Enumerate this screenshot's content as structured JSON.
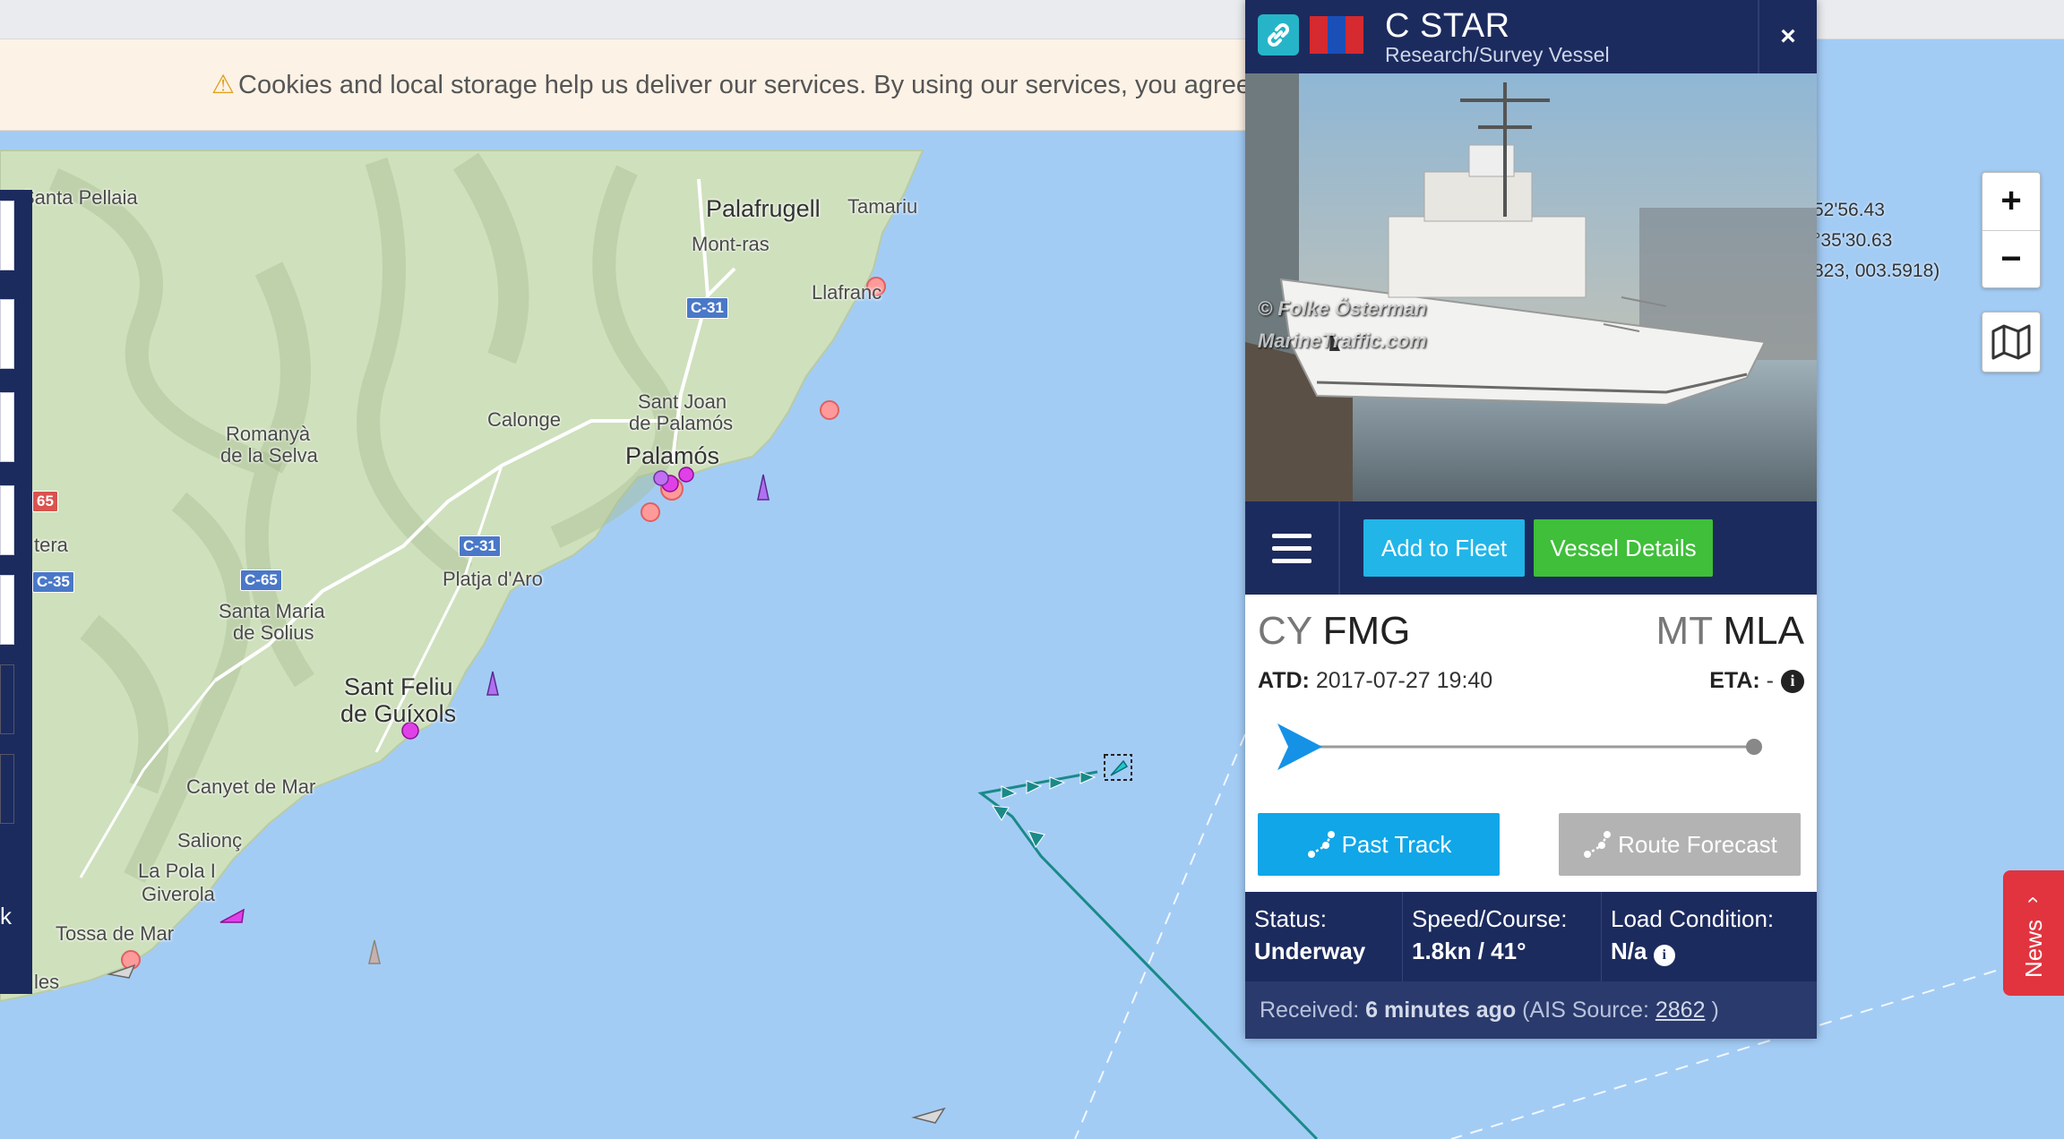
{
  "cookie_banner": {
    "icon": "warning-icon",
    "text": "Cookies and local storage help us deliver our services. By using our services, you agree t"
  },
  "map": {
    "place_labels": [
      "Santa Pellaia",
      "Palafrugell",
      "Tamariu",
      "Mont-ras",
      "Llafranc",
      "Sant Joan",
      "de Palamós",
      "Calonge",
      "Romanyà",
      "de la Selva",
      "Palamós",
      "Platja d'Aro",
      "Santa Maria",
      "de Solius",
      "Sant Feliu",
      "de Guíxols",
      "Canyet de Mar",
      "Salionç",
      "La Pola I",
      "Giverola",
      "Tossa de Mar",
      "tera",
      "les",
      "k"
    ],
    "road_labels": [
      "C-31",
      "C-31",
      "C-65",
      "C-65",
      "C-35",
      "65"
    ],
    "coords": [
      "52'56.43",
      "°35'30.63",
      "823, 003.5918)"
    ]
  },
  "map_controls": {
    "zoom_in": "+",
    "zoom_out": "−",
    "layers_icon": "map-layers-icon"
  },
  "news_tab": {
    "label": "News",
    "icon": "chevron-up-icon"
  },
  "vessel_panel": {
    "name": "C STAR",
    "type": "Research/Survey Vessel",
    "close": "×",
    "photo_credit": [
      "© Folke Österman",
      "MarineTraffic.com"
    ],
    "buttons": {
      "add_to_fleet": "Add to Fleet",
      "vessel_details": "Vessel Details",
      "past_track": "Past Track",
      "route_forecast": "Route Forecast"
    },
    "departure": {
      "country": "CY",
      "port": "FMG"
    },
    "arrival": {
      "country": "MT",
      "port": "MLA"
    },
    "atd_label": "ATD:",
    "atd_value": "2017-07-27 19:40",
    "eta_label": "ETA:",
    "eta_value": "-",
    "voyage_progress": 0.0,
    "status_label": "Status:",
    "status_value": "Underway",
    "speed_label": "Speed/Course:",
    "speed_value": "1.8kn / 41°",
    "load_label": "Load Condition:",
    "load_value": "N/a",
    "received_label": "Received:",
    "received_value": "6 minutes ago",
    "ais_label": "(AIS Source:",
    "ais_value": "2862",
    "ais_close": ")"
  },
  "colors": {
    "panel_navy": "#1c2b5e",
    "add_fleet_blue": "#22b5e8",
    "details_green": "#3fbf3a",
    "past_track_blue": "#10a6e8",
    "route_forecast_gray": "#b3b3b3",
    "sea": "#a3ccf5",
    "news_red": "#e1343f"
  }
}
